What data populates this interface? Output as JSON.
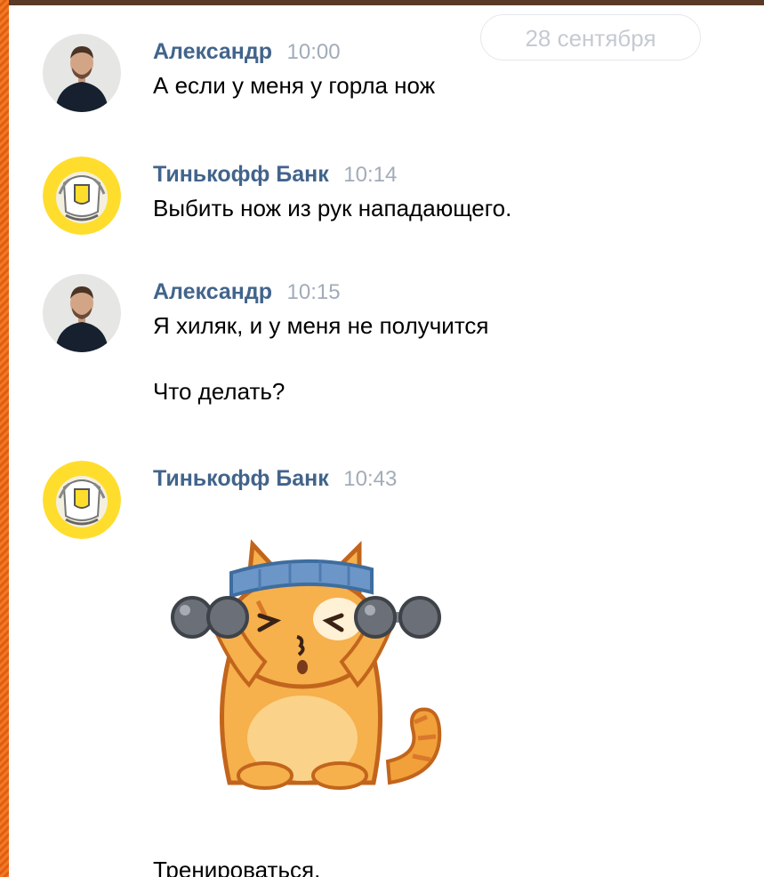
{
  "date_separator": "28 сентября",
  "messages": [
    {
      "author": "Александр",
      "time": "10:00",
      "avatar": "user-photo-avatar",
      "texts": [
        "А если у меня у горла нож"
      ]
    },
    {
      "author": "Тинькофф Банк",
      "time": "10:14",
      "avatar": "tinkoff-logo-avatar",
      "texts": [
        "Выбить нож из рук нападающего."
      ]
    },
    {
      "author": "Александр",
      "time": "10:15",
      "avatar": "user-photo-avatar",
      "texts": [
        "Я хиляк, и у меня не получится",
        "Что делать?"
      ]
    },
    {
      "author": "Тинькофф Банк",
      "time": "10:43",
      "avatar": "tinkoff-logo-avatar",
      "sticker": "cat-with-dumbbells-sticker",
      "texts": [
        "Тренироваться."
      ]
    }
  ],
  "colors": {
    "author": "#42648b",
    "time": "#a2acb8",
    "tinkoff_yellow": "#ffdd2d",
    "frame_orange": "#e8651a"
  }
}
